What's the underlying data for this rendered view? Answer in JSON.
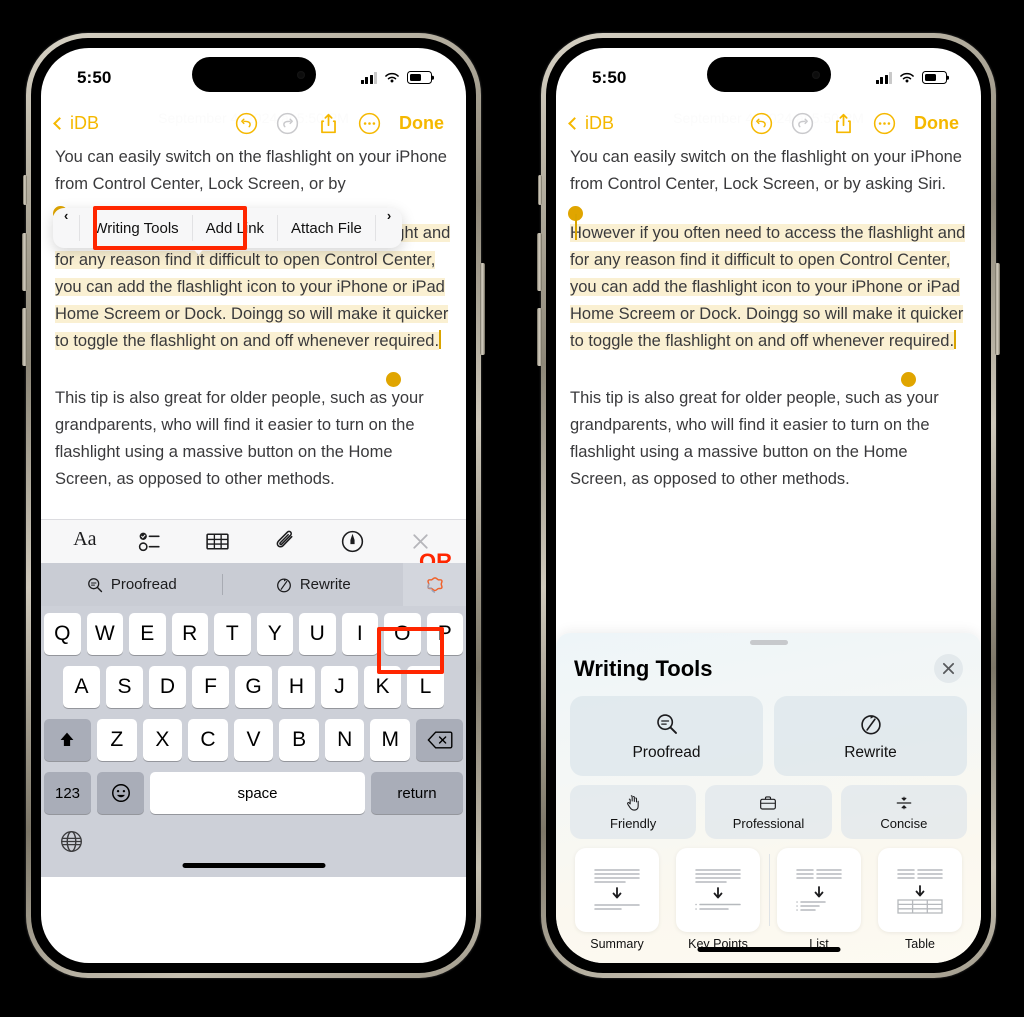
{
  "annotation": {
    "or_label": "OR"
  },
  "colors": {
    "accent_yellow": "#F5B800",
    "highlight_bg": "#faf0d2",
    "selection_handle": "#E0A500",
    "callout_red": "#FF2600",
    "keyboard_bg": "#cdd0d8",
    "ai_bar_bg": "#c9ccd4"
  },
  "status_bar": {
    "time": "5:50",
    "signal_bars_filled": 3,
    "signal_bars_total": 4,
    "wifi": "wifi-icon",
    "battery_level_percent": 55
  },
  "nav_bar": {
    "back_label": "iDB",
    "undo": "undo-icon",
    "redo": "redo-icon",
    "share": "share-icon",
    "more": "more-icon",
    "done_label": "Done"
  },
  "note": {
    "ghost_date": "September 4, 2024 at 5:50 PM",
    "paragraph_1_left": "You can easily switch on the flashlight on your iPhone from Control Center, Lock Screen, or by",
    "paragraph_1_right": "You can easily switch on the flashlight on your iPhone from Control Center, Lock Screen, or by asking Siri.",
    "selected_paragraph": "However if you often need to access the flashlight and for any reason find it difficult to open Control Center, you can add the flashlight icon to your iPhone or iPad Home Screem or Dock. Doingg so will make it quicker to toggle the flashlight on and off whenever required.",
    "paragraph_3": "This tip is also great for older people, such as your grandparents, who will find it easier to turn on the flashlight using a massive button on the Home Screen, as opposed to other methods."
  },
  "context_menu": {
    "prev_arrow": "‹",
    "next_arrow": "›",
    "items": [
      {
        "label": "Writing Tools",
        "highlighted": true
      },
      {
        "label": "Add Link",
        "highlighted": false
      },
      {
        "label": "Attach File",
        "highlighted": false
      }
    ]
  },
  "format_bar": {
    "items": [
      {
        "name": "text-format-icon",
        "label": "Aa"
      },
      {
        "name": "checklist-icon",
        "label": ""
      },
      {
        "name": "table-icon",
        "label": ""
      },
      {
        "name": "attachment-icon",
        "label": ""
      },
      {
        "name": "markup-pen-icon",
        "label": ""
      },
      {
        "name": "close-keyboard-icon",
        "label": ""
      }
    ]
  },
  "ai_bar": {
    "proofread_label": "Proofread",
    "rewrite_label": "Rewrite",
    "writing_tools_icon": "apple-intelligence-icon",
    "writing_tools_highlighted": true
  },
  "keyboard": {
    "row1": [
      "Q",
      "W",
      "E",
      "R",
      "T",
      "Y",
      "U",
      "I",
      "O",
      "P"
    ],
    "row2": [
      "A",
      "S",
      "D",
      "F",
      "G",
      "H",
      "J",
      "K",
      "L"
    ],
    "row3": [
      "Z",
      "X",
      "C",
      "V",
      "B",
      "N",
      "M"
    ],
    "shift_key": "shift-icon",
    "backspace_key": "backspace-icon",
    "numbers_key": "123",
    "emoji_key": "emoji-icon",
    "space_key": "space",
    "return_key": "return",
    "globe_key": "globe-icon"
  },
  "writing_tools_sheet": {
    "title": "Writing Tools",
    "close_label": "×",
    "primary": [
      {
        "label": "Proofread",
        "icon": "proofread-magnifier-icon"
      },
      {
        "label": "Rewrite",
        "icon": "rewrite-clock-icon"
      }
    ],
    "tones": [
      {
        "label": "Friendly",
        "icon": "wave-hand-icon"
      },
      {
        "label": "Professional",
        "icon": "briefcase-icon"
      },
      {
        "label": "Concise",
        "icon": "concise-arrows-icon"
      }
    ],
    "formats": [
      {
        "label": "Summary",
        "icon": "summary-doc-icon"
      },
      {
        "label": "Key Points",
        "icon": "key-points-doc-icon"
      },
      {
        "label": "List",
        "icon": "list-doc-icon"
      },
      {
        "label": "Table",
        "icon": "table-doc-icon"
      }
    ]
  }
}
